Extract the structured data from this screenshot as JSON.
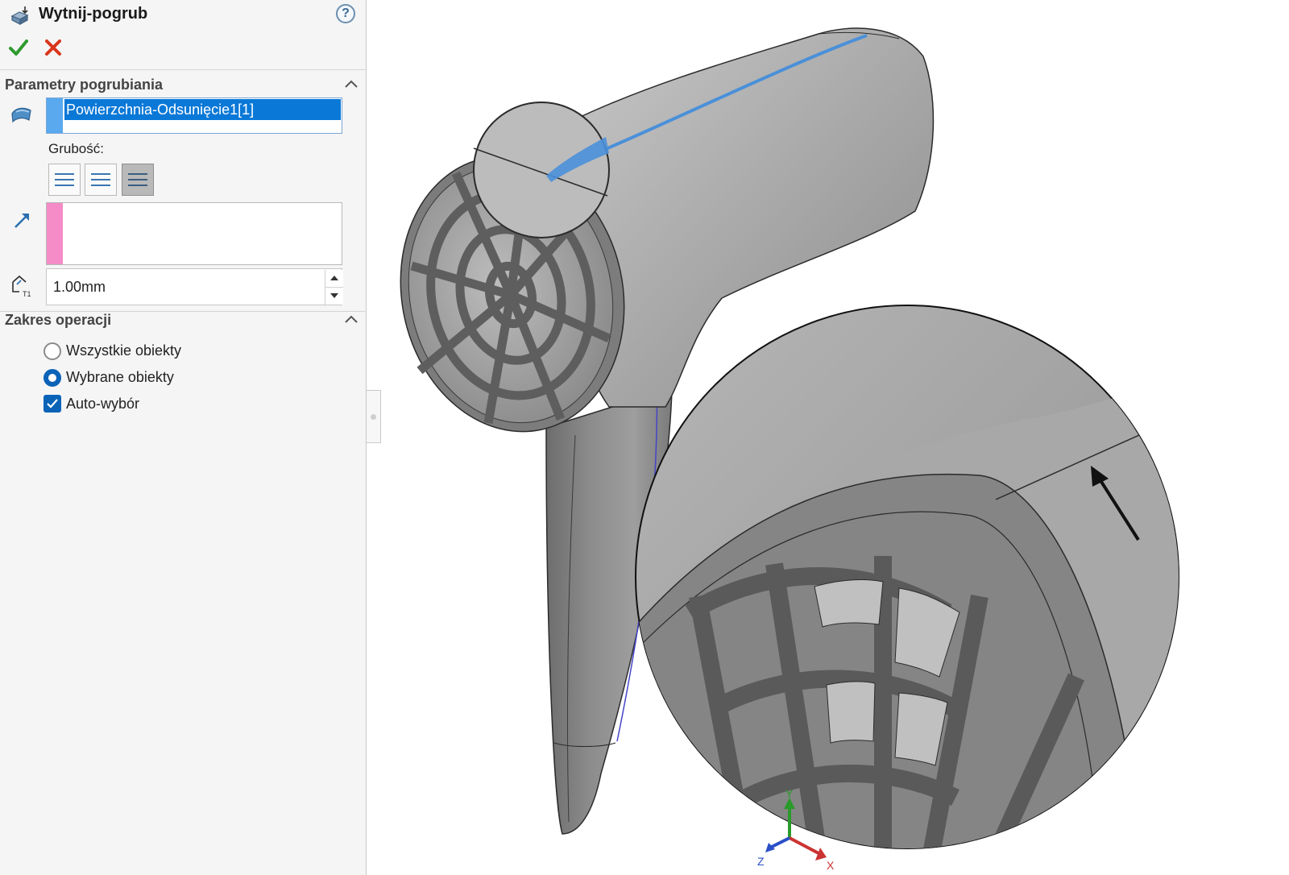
{
  "feature": {
    "title": "Wytnij-pogrub",
    "title_icon": "cut-thicken-feature-icon",
    "help_label": "?",
    "ok_icon": "green-checkmark-icon",
    "cancel_icon": "red-x-icon"
  },
  "thicken_params": {
    "section_title": "Parametry pogrubiania",
    "selected_surface": "Powierzchnia-Odsunięcie1[1]",
    "thickness_label": "Grubość:",
    "thickness_side_options": [
      "thicken-side-1-icon",
      "thicken-side-2-icon",
      "thicken-both-sides-icon"
    ],
    "active_thickness_option": "thicken-both-sides-icon",
    "thickness_value": "1.00mm",
    "thickness_field_icon": "thickness-t1-icon"
  },
  "feature_scope": {
    "section_title": "Zakres operacji",
    "options": [
      {
        "label": "Wszystkie obiekty",
        "selected": false
      },
      {
        "label": "Wybrane obiekty",
        "selected": true
      }
    ],
    "auto_select_label": "Auto-wybór",
    "auto_select_checked": true
  },
  "viewport": {
    "triad_labels": {
      "x": "X",
      "y": "Y",
      "z": "Z"
    },
    "selection_color": "#4a90d9",
    "model_color": "#9b9b9b"
  }
}
